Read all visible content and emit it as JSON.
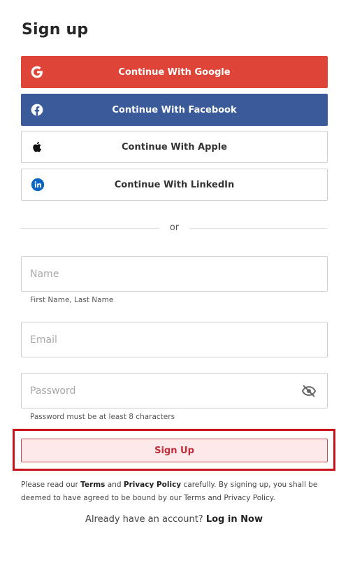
{
  "page": {
    "title": "Sign up"
  },
  "colors": {
    "google_bg": "#de4437",
    "facebook_bg": "#3b5a9a",
    "linkedin_blue": "#0a66c2",
    "highlight_red": "#c8111a",
    "signup_bg": "#fde9e9",
    "signup_text": "#c22d3a"
  },
  "social": {
    "google": {
      "label": "Continue With Google",
      "icon": "google-g-icon"
    },
    "facebook": {
      "label": "Continue With Facebook",
      "icon": "facebook-icon"
    },
    "apple": {
      "label": "Continue With Apple",
      "icon": "apple-icon"
    },
    "linkedin": {
      "label": "Continue With LinkedIn",
      "icon": "linkedin-icon"
    }
  },
  "divider": {
    "text": "or"
  },
  "form": {
    "name": {
      "placeholder": "Name",
      "value": "",
      "helper": "First Name, Last Name"
    },
    "email": {
      "placeholder": "Email",
      "value": ""
    },
    "password": {
      "placeholder": "Password",
      "value": "",
      "helper": "Password must be at least 8 characters",
      "toggle_icon": "eye-slash-icon"
    },
    "submit_label": "Sign Up"
  },
  "terms": {
    "prefix": "Please read our ",
    "terms_link": "Terms",
    "and1": " and ",
    "privacy_link": "Privacy Policy",
    "suffix": " carefully. By signing up, you shall be deemed to have agreed to be bound by our Terms and Privacy Policy."
  },
  "login": {
    "prompt": "Already have an account? ",
    "link": "Log in Now"
  }
}
